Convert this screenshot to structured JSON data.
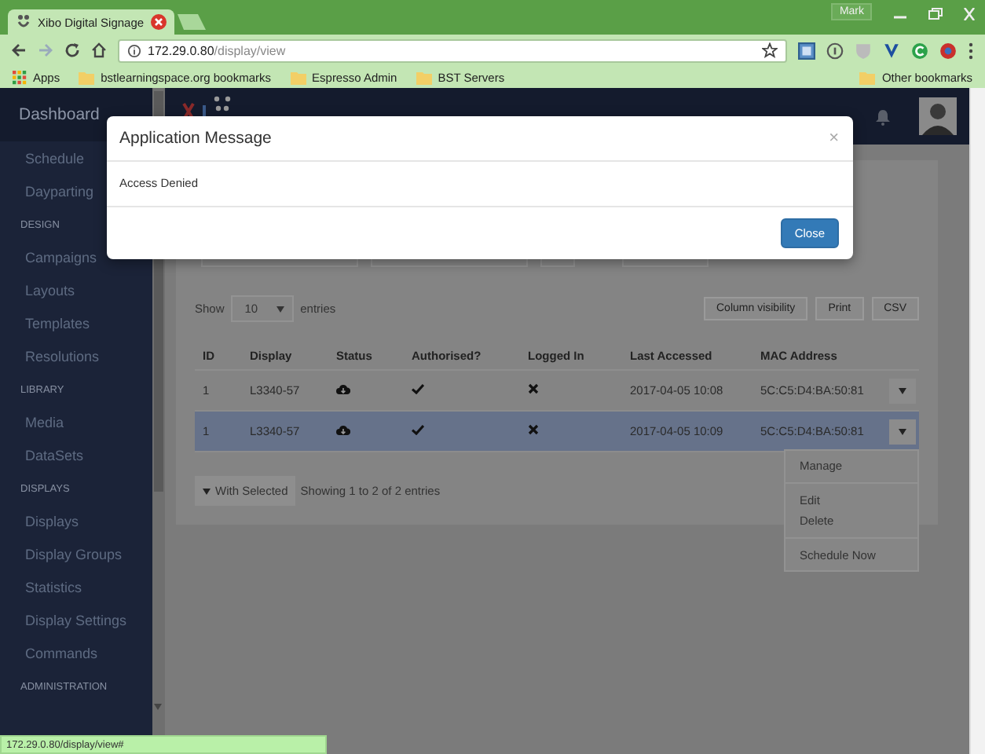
{
  "browser": {
    "tab_title": "Xibo Digital Signage",
    "user": "Mark",
    "url_host": "172.29.0.80",
    "url_path": "/display/view",
    "bookmarks": [
      {
        "label": "Apps",
        "kind": "apps"
      },
      {
        "label": "bstlearningspace.org bookmarks",
        "kind": "folder"
      },
      {
        "label": "Espresso Admin",
        "kind": "folder"
      },
      {
        "label": "BST Servers",
        "kind": "folder"
      }
    ],
    "other_bookmarks": "Other bookmarks",
    "status_url": "172.29.0.80/display/view#"
  },
  "sidebar": {
    "title": "Dashboard",
    "items": [
      {
        "label": "Schedule",
        "kind": "link"
      },
      {
        "label": "Dayparting",
        "kind": "link"
      },
      {
        "label": "DESIGN",
        "kind": "section"
      },
      {
        "label": "Campaigns",
        "kind": "link"
      },
      {
        "label": "Layouts",
        "kind": "link"
      },
      {
        "label": "Templates",
        "kind": "link"
      },
      {
        "label": "Resolutions",
        "kind": "link"
      },
      {
        "label": "LIBRARY",
        "kind": "section"
      },
      {
        "label": "Media",
        "kind": "link"
      },
      {
        "label": "DataSets",
        "kind": "link"
      },
      {
        "label": "DISPLAYS",
        "kind": "section"
      },
      {
        "label": "Displays",
        "kind": "link"
      },
      {
        "label": "Display Groups",
        "kind": "link"
      },
      {
        "label": "Statistics",
        "kind": "link"
      },
      {
        "label": "Display Settings",
        "kind": "link"
      },
      {
        "label": "Commands",
        "kind": "link"
      },
      {
        "label": "ADMINISTRATION",
        "kind": "section"
      }
    ]
  },
  "table_controls": {
    "show_label": "Show",
    "page_size": "10",
    "entries_label": "entries",
    "buttons": [
      "Column visibility",
      "Print",
      "CSV"
    ]
  },
  "table": {
    "columns": [
      "ID",
      "Display",
      "Status",
      "Authorised?",
      "Logged In",
      "Last Accessed",
      "MAC Address"
    ],
    "rows": [
      {
        "id": "1",
        "display": "L3340-57",
        "authorised": true,
        "logged_in": false,
        "last_accessed": "2017-04-05 10:08",
        "mac_address": "5C:C5:D4:BA:50:81",
        "selected": false
      },
      {
        "id": "1",
        "display": "L3340-57",
        "authorised": true,
        "logged_in": false,
        "last_accessed": "2017-04-05 10:09",
        "mac_address": "5C:C5:D4:BA:50:81",
        "selected": true
      }
    ]
  },
  "footer": {
    "bulk_button": "With Selected",
    "info": "Showing 1 to 2 of 2 entries"
  },
  "row_menu": {
    "groups": [
      [
        "Manage"
      ],
      [
        "Edit",
        "Delete"
      ],
      [
        "Schedule Now"
      ]
    ]
  },
  "modal": {
    "title": "Application Message",
    "close_glyph": "×",
    "message": "Access Denied",
    "button": "Close"
  }
}
